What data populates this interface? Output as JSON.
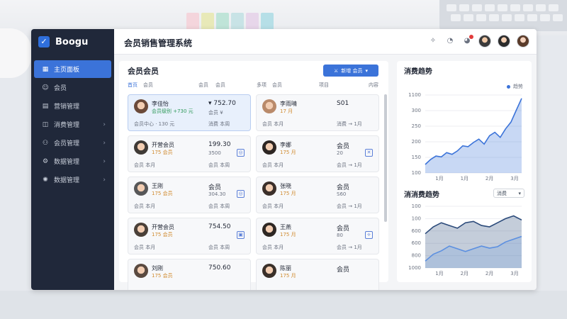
{
  "app": {
    "brand": "Boogu",
    "title": "会员销售管理系统"
  },
  "sidebar": {
    "items": [
      {
        "label": "主页面板",
        "icon": "grid-icon",
        "active": true,
        "chevron": false
      },
      {
        "label": "会员",
        "icon": "person-icon",
        "active": false,
        "chevron": false
      },
      {
        "label": "营销管理",
        "icon": "doc-icon",
        "active": false,
        "chevron": false
      },
      {
        "label": "消费管理",
        "icon": "cart-icon",
        "active": false,
        "chevron": true
      },
      {
        "label": "会员管理",
        "icon": "users-icon",
        "active": false,
        "chevron": true
      },
      {
        "label": "数据管理",
        "icon": "gear-icon",
        "active": false,
        "chevron": true
      },
      {
        "label": "数据管理",
        "icon": "cog-icon",
        "active": false,
        "chevron": true
      }
    ]
  },
  "main": {
    "title": "会员会员",
    "button_label": "新增 会员",
    "tabs": [
      "首页",
      "会员",
      "会员",
      "会员",
      "多项",
      "会员",
      "项目",
      "内容"
    ],
    "cards": [
      {
        "name": "李佳怡",
        "sub": "会员级别 +730 元",
        "tag": "会员中心 · 130 元",
        "value": "▾ 752.70",
        "vsub": "会员 ¥",
        "vtag": "消费 本周",
        "selected": true,
        "icon": ""
      },
      {
        "name": "李雨晴",
        "sub": "17 月",
        "tag": "会员 本月",
        "value": "S01",
        "vsub": "",
        "vtag": "消费 → 1月",
        "selected": false,
        "icon": ""
      },
      {
        "name": "开营会员",
        "sub": "175 会员",
        "tag": "会员 本月",
        "value": "199.30",
        "vsub": "3500",
        "vtag": "会员 本周",
        "selected": false,
        "icon": "◎"
      },
      {
        "name": "李娜",
        "sub": "175 月",
        "tag": "会员 本月",
        "value": "会员",
        "vsub": "20",
        "vtag": "会员 → 1月",
        "selected": false,
        "icon": "✕"
      },
      {
        "name": "王刚",
        "sub": "175 会员",
        "tag": "会员 本月",
        "value": "会员",
        "vsub": "304.30",
        "vtag": "会员 本周",
        "selected": false,
        "icon": "◎"
      },
      {
        "name": "张晓",
        "sub": "175 月",
        "tag": "会员 本月",
        "value": "会员",
        "vsub": "S60",
        "vtag": "会员 → 1月",
        "selected": false,
        "icon": ""
      },
      {
        "name": "开营会员",
        "sub": "175 会员",
        "tag": "会员 本月",
        "value": "754.50",
        "vsub": "",
        "vtag": "会员 本周",
        "selected": false,
        "icon": "▣"
      },
      {
        "name": "王燕",
        "sub": "175 月",
        "tag": "会员 本月",
        "value": "会员",
        "vsub": "80",
        "vtag": "会员 → 1月",
        "selected": false,
        "icon": "⟡"
      },
      {
        "name": "刘刚",
        "sub": "175 会员",
        "tag": "",
        "value": "750.60",
        "vsub": "",
        "vtag": "",
        "selected": false,
        "icon": ""
      },
      {
        "name": "陈丽",
        "sub": "175 月",
        "tag": "",
        "value": "会员",
        "vsub": "",
        "vtag": "",
        "selected": false,
        "icon": ""
      }
    ]
  },
  "charts": {
    "top": {
      "title": "消费趋势",
      "legend_label": "趋势"
    },
    "bottom": {
      "title": "消消费趋势",
      "select_value": "消费"
    }
  },
  "chart_data": [
    {
      "type": "area",
      "title": "消费趋势",
      "x": [
        "1月",
        "1月",
        "2月",
        "3月"
      ],
      "yticks": [
        100,
        150,
        200,
        250,
        300,
        1100
      ],
      "series": [
        {
          "name": "趋势",
          "color": "#3b73d9",
          "values": [
            150,
            180,
            200,
            195,
            220,
            210,
            230,
            260,
            255,
            280,
            300,
            270,
            320,
            340,
            310,
            360,
            400,
            470,
            540
          ]
        }
      ]
    },
    {
      "type": "area",
      "title": "消消费趋势",
      "x": [
        "1月",
        "2月",
        "2月",
        "3月"
      ],
      "yticks": [
        1000,
        800,
        600,
        600,
        100,
        100
      ],
      "series": [
        {
          "name": "",
          "color": "#2b4a7a",
          "values": [
            600,
            700,
            760,
            720,
            680,
            760,
            780,
            720,
            700,
            760,
            820,
            860,
            800
          ]
        },
        {
          "name": "",
          "color": "#5b8fe0",
          "values": [
            200,
            300,
            350,
            420,
            380,
            340,
            380,
            420,
            390,
            410,
            480,
            520,
            560
          ]
        }
      ]
    }
  ],
  "colors": {
    "accent": "#3b73d9",
    "sidebar": "#20283a"
  }
}
